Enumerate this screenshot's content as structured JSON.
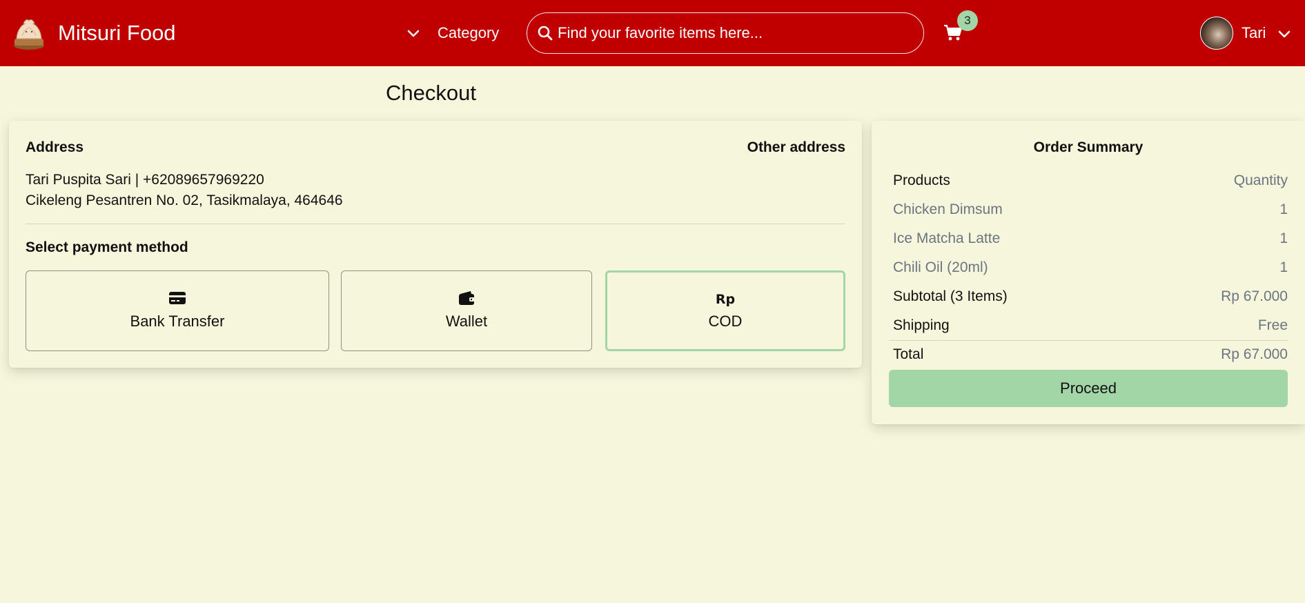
{
  "header": {
    "brand": "Mitsuri Food",
    "category_label": "Category",
    "search_placeholder": "Find your favorite items here...",
    "cart_count": "3",
    "user_name": "Tari",
    "bg_color": "#c00000",
    "accent_color": "#a3d6a7"
  },
  "page": {
    "title": "Checkout"
  },
  "address": {
    "label": "Address",
    "other_link": "Other address",
    "name_phone": "Tari Puspita Sari | +62089657969220",
    "street": "Cikeleng Pesantren No. 02, Tasikmalaya, 464646"
  },
  "payment": {
    "label": "Select payment method",
    "options": [
      {
        "label": "Bank Transfer",
        "icon": "credit-card-icon",
        "selected": false
      },
      {
        "label": "Wallet",
        "icon": "wallet-icon",
        "selected": false
      },
      {
        "label": "COD",
        "icon": "rupiah-icon",
        "icon_text": "Rp",
        "selected": true
      }
    ]
  },
  "summary": {
    "title": "Order Summary",
    "products_header": "Products",
    "quantity_header": "Quantity",
    "items": [
      {
        "name": "Chicken Dimsum",
        "qty": "1"
      },
      {
        "name": "Ice Matcha Latte",
        "qty": "1"
      },
      {
        "name": "Chili Oil (20ml)",
        "qty": "1"
      }
    ],
    "subtotal_label": "Subtotal (3 Items)",
    "subtotal_value": "Rp 67.000",
    "shipping_label": "Shipping",
    "shipping_value": "Free",
    "total_label": "Total",
    "total_value": "Rp 67.000",
    "proceed_label": "Proceed"
  }
}
